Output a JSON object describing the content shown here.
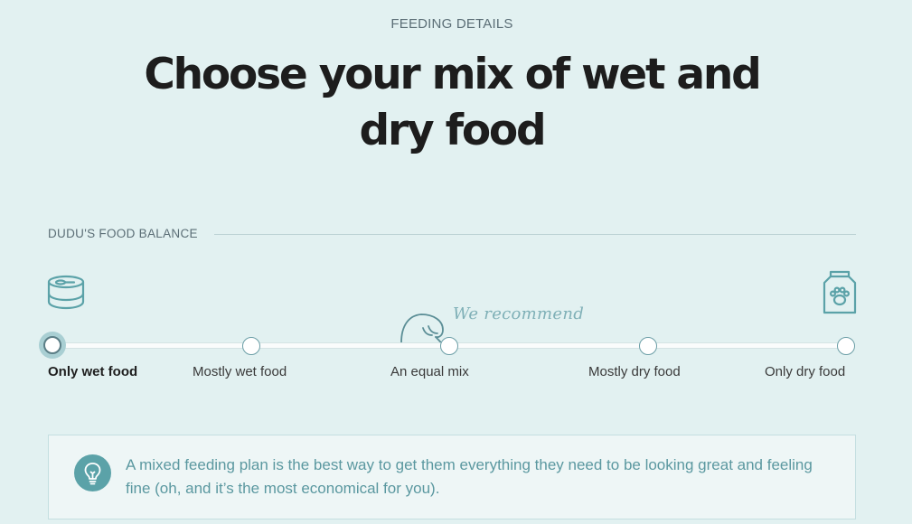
{
  "header": {
    "eyebrow": "FEEDING DETAILS",
    "title_line1": "Choose your mix of wet and",
    "title_line2": "dry food"
  },
  "balance": {
    "section_label": "DUDU'S FOOD BALANCE",
    "recommend_note": "We recommend",
    "options": [
      {
        "label": "Only wet food",
        "selected": true
      },
      {
        "label": "Mostly wet food",
        "selected": false
      },
      {
        "label": "An equal mix",
        "selected": false,
        "recommended": true
      },
      {
        "label": "Mostly dry food",
        "selected": false
      },
      {
        "label": "Only dry food",
        "selected": false
      }
    ],
    "left_icon": "wet-food-can-icon",
    "right_icon": "dry-food-bag-icon"
  },
  "tip": {
    "icon": "lightbulb-icon",
    "text": "A mixed feeding plan is the best way to get them everything they need to be looking great and feeling fine (oh, and it’s the most economical for you)."
  },
  "colors": {
    "background": "#e2f1f1",
    "accent": "#5ba2a8",
    "tip_text": "#5b98a0"
  }
}
